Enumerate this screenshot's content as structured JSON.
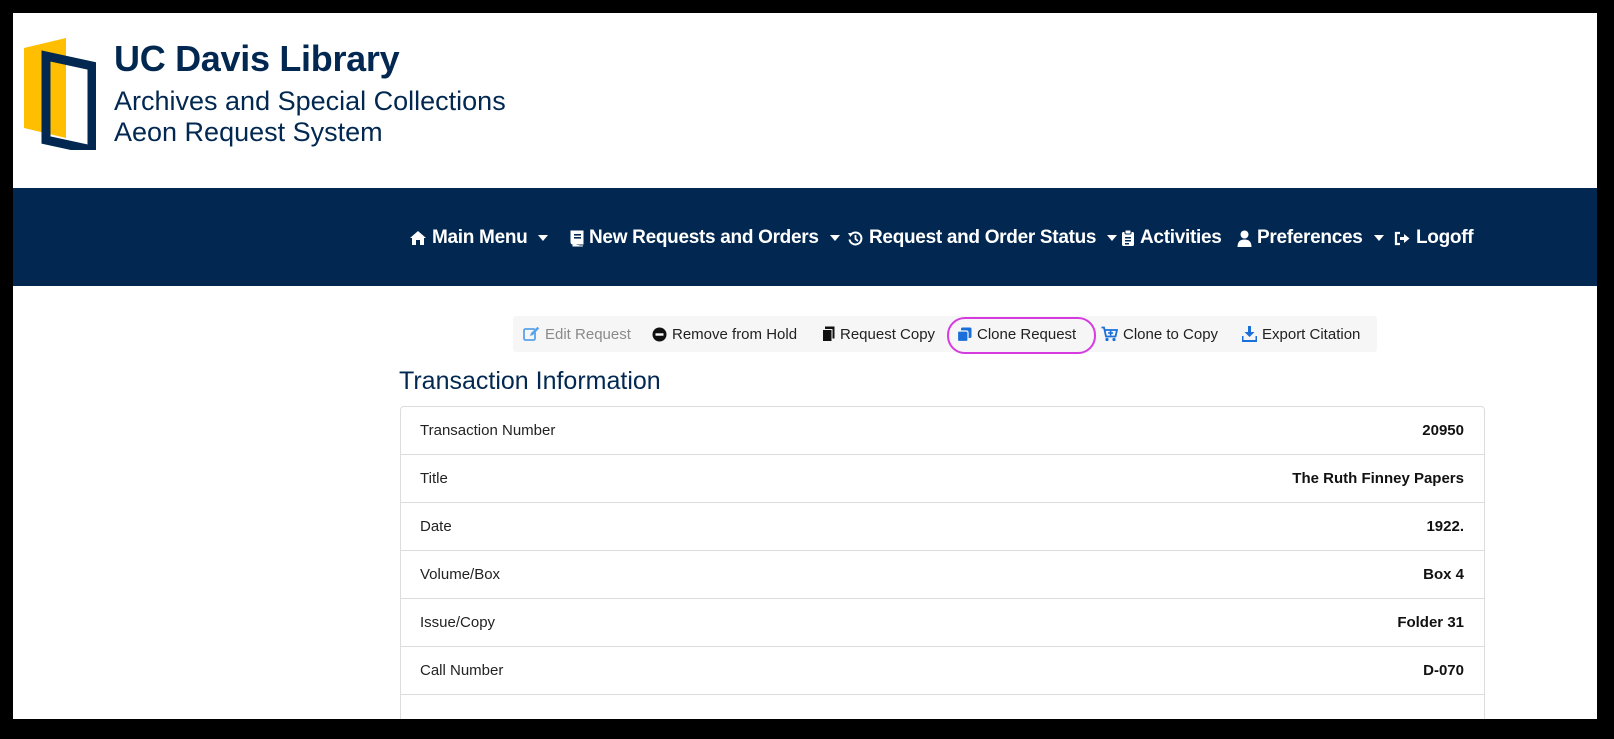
{
  "brand": {
    "title": "UC Davis Library",
    "subtitle1": "Archives and Special Collections",
    "subtitle2": "Aeon Request System",
    "colors": {
      "navy": "#022851",
      "gold": "#FFBF00"
    }
  },
  "nav": {
    "items": [
      {
        "label": "Main Menu",
        "icon": "home-icon",
        "dropdown": true
      },
      {
        "label": "New Requests and Orders",
        "icon": "book-icon",
        "dropdown": true
      },
      {
        "label": "Request and Order Status",
        "icon": "history-icon",
        "dropdown": true
      },
      {
        "label": "Activities",
        "icon": "clipboard-icon",
        "dropdown": false
      },
      {
        "label": "Preferences",
        "icon": "user-icon",
        "dropdown": true
      },
      {
        "label": "Logoff",
        "icon": "sign-out-icon",
        "dropdown": false
      }
    ]
  },
  "toolbar": {
    "edit": "Edit Request",
    "remove": "Remove from Hold",
    "copy": "Request Copy",
    "clone": "Clone Request",
    "clone_copy": "Clone to Copy",
    "export": "Export Citation"
  },
  "transaction": {
    "heading": "Transaction Information",
    "rows": [
      {
        "label": "Transaction Number",
        "value": "20950"
      },
      {
        "label": "Title",
        "value": "The Ruth Finney Papers"
      },
      {
        "label": "Date",
        "value": "1922."
      },
      {
        "label": "Volume/Box",
        "value": "Box 4"
      },
      {
        "label": "Issue/Copy",
        "value": "Folder 31"
      },
      {
        "label": "Call Number",
        "value": "D-070"
      }
    ]
  }
}
